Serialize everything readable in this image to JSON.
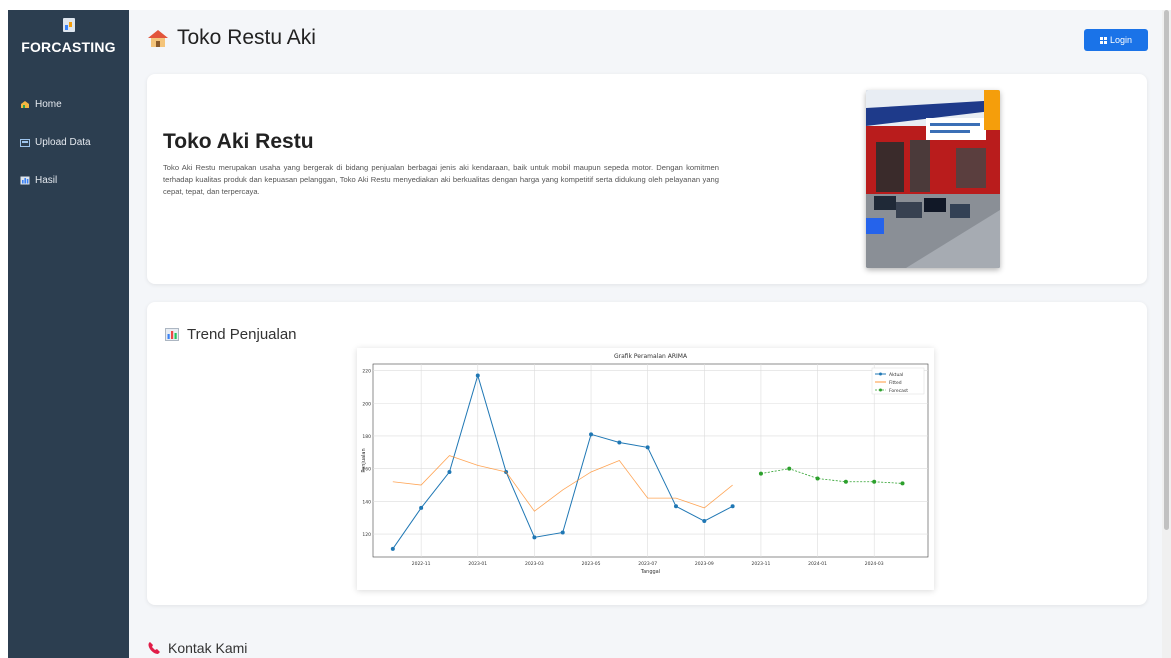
{
  "brand": {
    "title": "FORCASTING",
    "icon": "chart-icon"
  },
  "sidebar": {
    "items": [
      {
        "label": "Home",
        "icon": "home-icon"
      },
      {
        "label": "Upload Data",
        "icon": "upload-icon"
      },
      {
        "label": "Hasil",
        "icon": "chart-bar-icon"
      }
    ]
  },
  "header": {
    "title": "Toko Restu Aki",
    "icon": "house-icon",
    "login_label": "Login"
  },
  "about": {
    "title": "Toko Aki Restu",
    "description": "Toko Aki Restu merupakan usaha yang bergerak di bidang penjualan berbagai jenis aki kendaraan, baik untuk mobil maupun sepeda motor. Dengan komitmen terhadap kualitas produk dan kepuasan pelanggan, Toko Aki Restu menyediakan aki berkualitas dengan harga yang kompetitif serta didukung oleh pelayanan yang cepat, tepat, dan terpercaya."
  },
  "trend": {
    "title": "Trend Penjualan",
    "icon": "bar-chart-icon"
  },
  "contact": {
    "title": "Kontak Kami",
    "icon": "phone-icon"
  },
  "colors": {
    "sidebar": "#2c3e50",
    "accent": "#1a73e8",
    "actual": "#1f77b4",
    "fitted": "#ff7f0e",
    "forecast": "#2ca02c"
  },
  "chart_data": {
    "type": "line",
    "title": "Grafik Peramalan ARIMA",
    "xlabel": "Tanggal",
    "ylabel": "Penjualan",
    "x_ticks": [
      "2022-11",
      "2023-01",
      "2023-03",
      "2023-05",
      "2023-07",
      "2023-09",
      "2023-11",
      "2024-01",
      "2024-03"
    ],
    "y_ticks": [
      120,
      140,
      160,
      180,
      200,
      220
    ],
    "ylim": [
      106,
      224
    ],
    "grid": true,
    "legend_position": "top-right",
    "series": [
      {
        "name": "Aktual",
        "x": [
          "2022-10",
          "2022-11",
          "2022-12",
          "2023-01",
          "2023-02",
          "2023-03",
          "2023-04",
          "2023-05",
          "2023-06",
          "2023-07",
          "2023-08",
          "2023-09",
          "2023-10"
        ],
        "values": [
          111,
          136,
          158,
          217,
          158,
          118,
          121,
          181,
          176,
          173,
          137,
          128,
          137
        ]
      },
      {
        "name": "Fitted",
        "x": [
          "2022-10",
          "2022-11",
          "2022-12",
          "2023-01",
          "2023-02",
          "2023-03",
          "2023-04",
          "2023-05",
          "2023-06",
          "2023-07",
          "2023-08",
          "2023-09",
          "2023-10"
        ],
        "values": [
          152,
          150,
          168,
          162,
          158,
          134,
          147,
          158,
          165,
          142,
          142,
          136,
          150
        ]
      },
      {
        "name": "Forecast",
        "x": [
          "2023-11",
          "2023-12",
          "2024-01",
          "2024-02",
          "2024-03",
          "2024-04"
        ],
        "values": [
          157,
          160,
          154,
          152,
          152,
          151
        ]
      }
    ]
  }
}
